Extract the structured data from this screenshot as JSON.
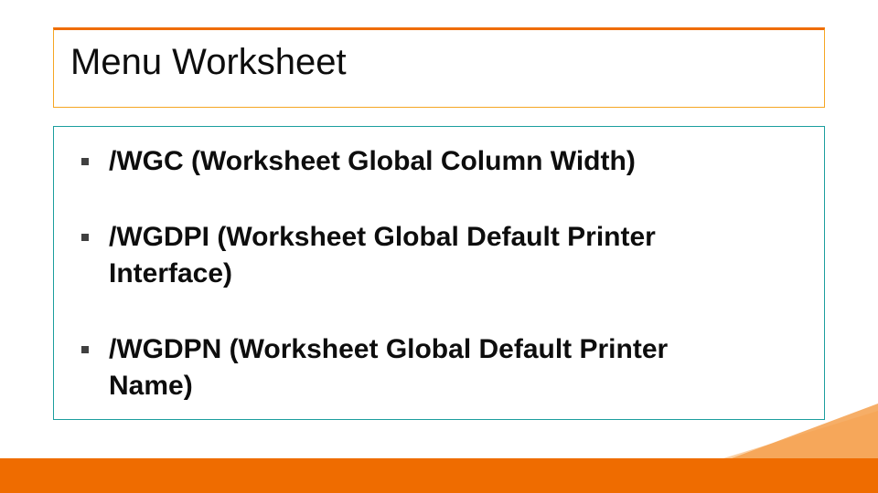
{
  "title": "Menu Worksheet",
  "bullets": [
    {
      "line1": "/WGC (Worksheet Global Column Width)",
      "line2": ""
    },
    {
      "line1": "/WGDPI (Worksheet Global Default Printer",
      "line2": "Interface)"
    },
    {
      "line1": "/WGDPN (Worksheet Global Default Printer",
      "line2": "Name)"
    }
  ],
  "colors": {
    "accent": "#ef6c00",
    "body_border": "#1b9e9e",
    "title_border": "#f5a623"
  }
}
